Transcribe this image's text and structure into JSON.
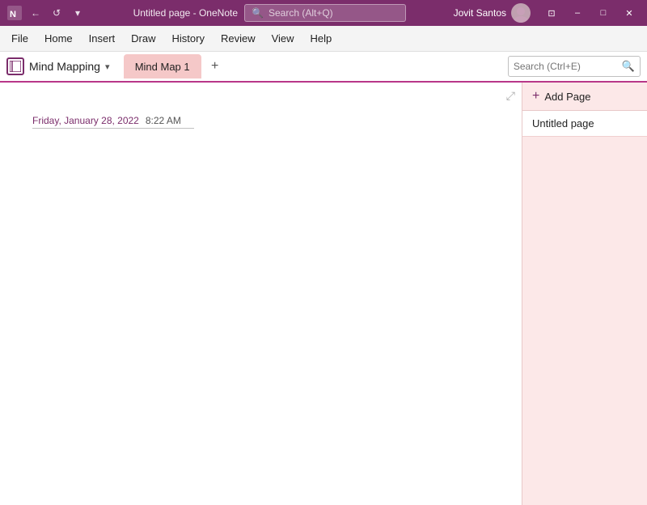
{
  "titlebar": {
    "app_title": "Untitled page - OneNote",
    "search_placeholder": "Search (Alt+Q)",
    "back_icon": "←",
    "undo_icon": "↩",
    "more_icon": "•••",
    "user_name": "Jovit Santos",
    "ribbon_icon": "⊡",
    "minimize_label": "─",
    "maximize_label": "□",
    "close_label": "✕"
  },
  "menubar": {
    "items": [
      {
        "label": "File",
        "id": "file"
      },
      {
        "label": "Home",
        "id": "home"
      },
      {
        "label": "Insert",
        "id": "insert"
      },
      {
        "label": "Draw",
        "id": "draw"
      },
      {
        "label": "History",
        "id": "history"
      },
      {
        "label": "Review",
        "id": "review"
      },
      {
        "label": "View",
        "id": "view"
      },
      {
        "label": "Help",
        "id": "help"
      }
    ]
  },
  "notebook": {
    "name": "Mind Mapping",
    "dropdown_icon": "▾",
    "search_placeholder": "Search (Ctrl+E)",
    "search_icon": "🔍"
  },
  "tabs": [
    {
      "label": "Mind Map 1",
      "active": true
    },
    {
      "label": "+",
      "is_add": true
    }
  ],
  "page": {
    "date": "Friday, January 28, 2022",
    "time": "8:22 AM",
    "expand_icon": "⤢"
  },
  "right_panel": {
    "add_page_label": "Add Page",
    "add_icon": "+",
    "pages": [
      {
        "label": "Untitled page",
        "active": true
      }
    ]
  },
  "colors": {
    "titlebar_bg": "#7B2D6B",
    "accent": "#b83789",
    "tab_bg": "#f5c8c8",
    "right_panel_bg": "#fce8e8",
    "date_color": "#7B2D6B"
  }
}
